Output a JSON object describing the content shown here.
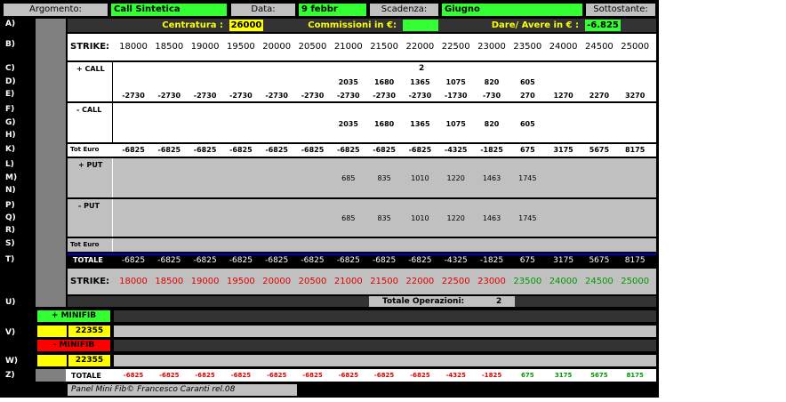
{
  "header": {
    "argomento_label": "Argomento:",
    "argomento_value": "Call Sintetica",
    "data_label": "Data:",
    "data_value": "9 febbr",
    "scadenza_label": "Scadenza:",
    "scadenza_value": "Giugno",
    "sottostante_label": "Sottostante:"
  },
  "row_a": {
    "centratura_label": "Centratura :",
    "centratura_value": "26000",
    "commissioni_label": "Commissioni in €:",
    "commissioni_value": "",
    "dare_avere_label": "Dare/ Avere in € :",
    "dare_avere_value": "-6.825"
  },
  "row_letters": [
    "A)",
    "B)",
    "C)",
    "D)",
    "E)",
    "F)",
    "G)",
    "H)",
    "K)",
    "L)",
    "M)",
    "N)",
    "P)",
    "Q)",
    "R)",
    "S)",
    "T)",
    "U)",
    "V)",
    "W)",
    "Z)"
  ],
  "strike_label": "STRIKE:",
  "strikes": [
    "18000",
    "18500",
    "19000",
    "19500",
    "20000",
    "20500",
    "21000",
    "21500",
    "22000",
    "22500",
    "23000",
    "23500",
    "24000",
    "24500",
    "25000"
  ],
  "call_plus": {
    "label": "+ CALL",
    "qty": "2",
    "premiums": [
      "",
      "",
      "",
      "",
      "",
      "",
      "2035",
      "1680",
      "1365",
      "1075",
      "820",
      "605",
      "",
      "",
      ""
    ],
    "values": [
      "-2730",
      "-2730",
      "-2730",
      "-2730",
      "-2730",
      "-2730",
      "-2730",
      "-2730",
      "-2730",
      "-1730",
      "-730",
      "270",
      "1270",
      "2270",
      "3270"
    ]
  },
  "call_minus": {
    "label": "- CALL",
    "premiums": [
      "",
      "",
      "",
      "",
      "",
      "",
      "2035",
      "1680",
      "1365",
      "1075",
      "820",
      "605",
      "",
      "",
      ""
    ]
  },
  "tot_euro_call": {
    "label": "Tot Euro",
    "values": [
      "-6825",
      "-6825",
      "-6825",
      "-6825",
      "-6825",
      "-6825",
      "-6825",
      "-6825",
      "-6825",
      "-4325",
      "-1825",
      "675",
      "3175",
      "5675",
      "8175"
    ]
  },
  "put_plus": {
    "label": "+ PUT",
    "premiums": [
      "",
      "",
      "",
      "",
      "",
      "",
      "685",
      "835",
      "1010",
      "1220",
      "1463",
      "1745",
      "",
      "",
      ""
    ]
  },
  "put_minus": {
    "label": "- PUT",
    "premiums": [
      "",
      "",
      "",
      "",
      "",
      "",
      "685",
      "835",
      "1010",
      "1220",
      "1463",
      "1745",
      "",
      "",
      ""
    ]
  },
  "tot_euro_put": {
    "label": "Tot Euro"
  },
  "totale": {
    "label": "TOTALE",
    "values": [
      "-6825",
      "-6825",
      "-6825",
      "-6825",
      "-6825",
      "-6825",
      "-6825",
      "-6825",
      "-6825",
      "-4325",
      "-1825",
      "675",
      "3175",
      "5675",
      "8175"
    ]
  },
  "strike_colored": {
    "negative_color": "#e00000",
    "positive_color": "#009900",
    "sign": [
      "neg",
      "neg",
      "neg",
      "neg",
      "neg",
      "neg",
      "neg",
      "neg",
      "neg",
      "neg",
      "neg",
      "pos",
      "pos",
      "pos",
      "pos"
    ]
  },
  "totale_operazioni": {
    "label": "Totale Operazioni:",
    "value": "2"
  },
  "minifib": {
    "plus_label": "+ MINIFIB",
    "plus_value": "22355",
    "minus_label": "- MINIFIB",
    "minus_value": "22355"
  },
  "bottom_totale": {
    "label": "TOTALE",
    "values": [
      "-6825",
      "-6825",
      "-6825",
      "-6825",
      "-6825",
      "-6825",
      "-6825",
      "-6825",
      "-6825",
      "-4325",
      "-1825",
      "675",
      "3175",
      "5675",
      "8175"
    ]
  },
  "footer": "Panel Mini Fib©  Francesco Caranti  rel.08"
}
